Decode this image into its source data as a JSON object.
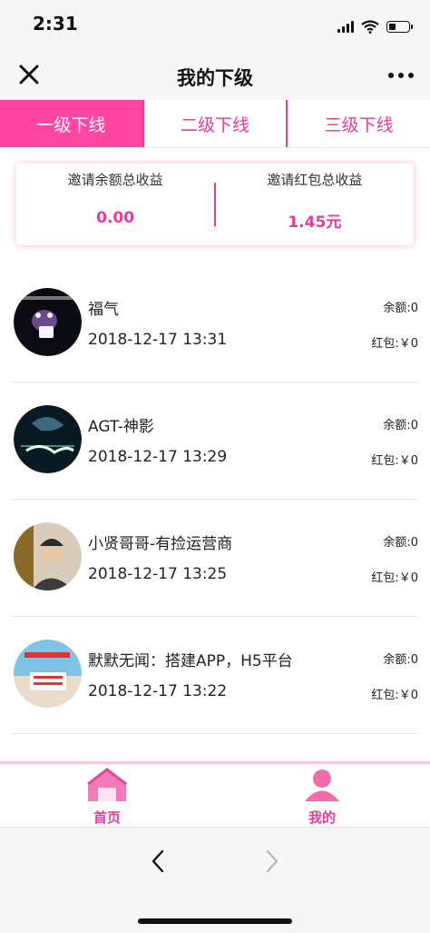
{
  "status": {
    "time": "2:31",
    "battery_level": 0.35
  },
  "nav": {
    "title": "我的下级",
    "close_icon": "close-icon",
    "more_icon": "more-icon"
  },
  "tabs": [
    {
      "label": "一级下线",
      "active": true
    },
    {
      "label": "二级下线",
      "active": false
    },
    {
      "label": "三级下线",
      "active": false
    }
  ],
  "stats": {
    "balance_label": "邀请余额总收益",
    "balance_value": "0.00",
    "redpacket_label": "邀请红包总收益",
    "redpacket_value": "1.45元"
  },
  "members": [
    {
      "name": "福气",
      "date": "2018-12-17 13:31",
      "balance": "余额:0",
      "red": "红包:￥0"
    },
    {
      "name": "AGT-神影",
      "date": "2018-12-17 13:29",
      "balance": "余额:0",
      "red": "红包:￥0"
    },
    {
      "name": "小贤哥哥-有捡运营商",
      "date": "2018-12-17 13:25",
      "balance": "余额:0",
      "red": "红包:￥0"
    },
    {
      "name": "默默无闻：搭建APP，H5平台",
      "date": "2018-12-17 13:22",
      "balance": "余额:0",
      "red": "红包:￥0"
    }
  ],
  "tabbar": {
    "home_label": "首页",
    "mine_label": "我的"
  },
  "colors": {
    "accent": "#ea3c9a",
    "tab_active": "#ff46a3"
  }
}
